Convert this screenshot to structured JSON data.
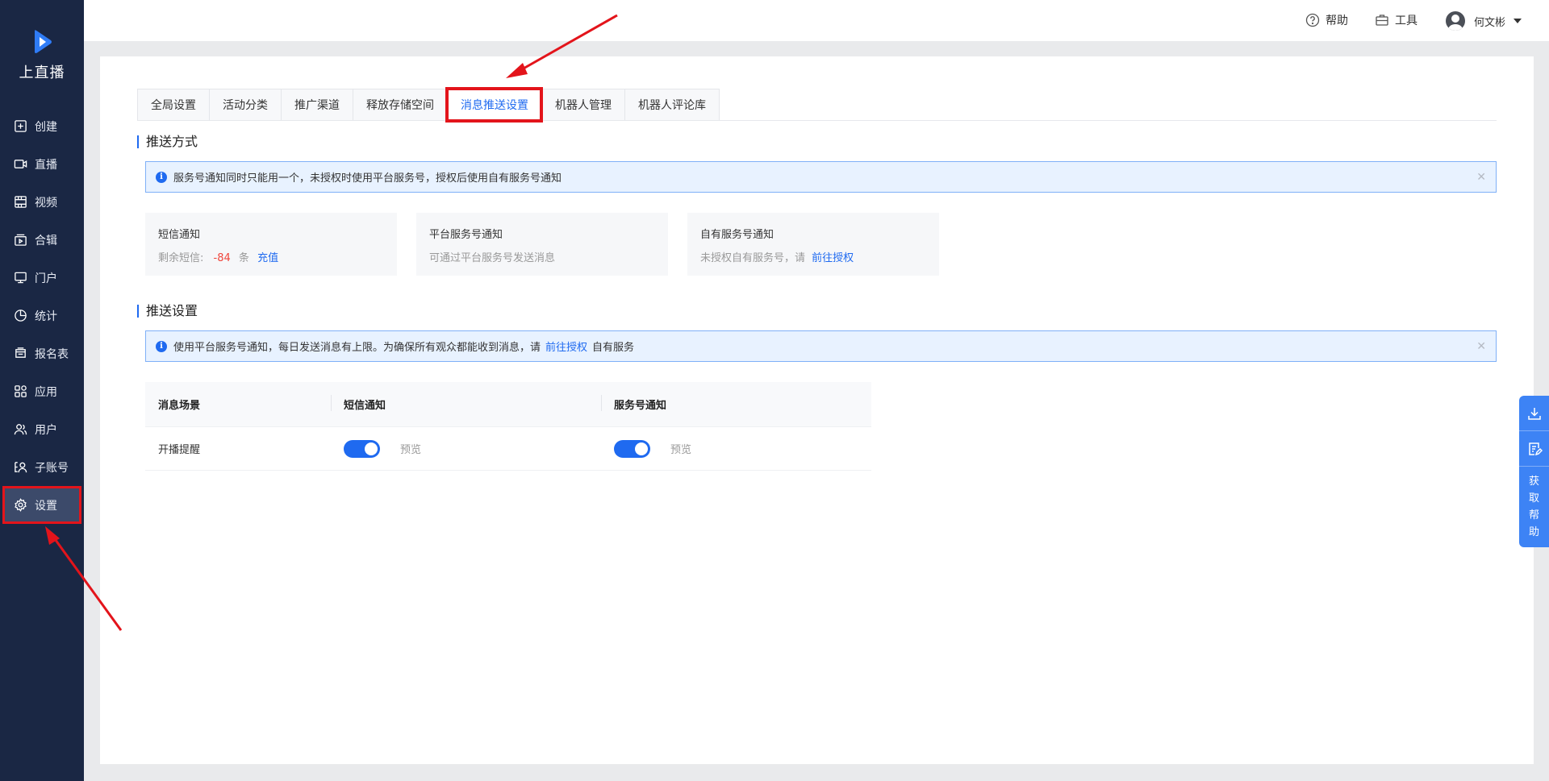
{
  "brand": {
    "name": "上直播"
  },
  "sidebar": {
    "items": [
      {
        "label": "创建",
        "icon": "plus-square-icon"
      },
      {
        "label": "直播",
        "icon": "video-camera-icon"
      },
      {
        "label": "视频",
        "icon": "film-icon"
      },
      {
        "label": "合辑",
        "icon": "collection-icon"
      },
      {
        "label": "门户",
        "icon": "monitor-icon"
      },
      {
        "label": "统计",
        "icon": "pie-chart-icon"
      },
      {
        "label": "报名表",
        "icon": "form-icon"
      },
      {
        "label": "应用",
        "icon": "apps-icon"
      },
      {
        "label": "用户",
        "icon": "users-icon"
      },
      {
        "label": "子账号",
        "icon": "sub-account-icon"
      },
      {
        "label": "设置",
        "icon": "gear-icon",
        "active": true
      }
    ]
  },
  "header": {
    "help": "帮助",
    "tools": "工具",
    "user": "何文彬"
  },
  "tabs": [
    "全局设置",
    "活动分类",
    "推广渠道",
    "释放存储空间",
    "消息推送设置",
    "机器人管理",
    "机器人评论库"
  ],
  "active_tab": "消息推送设置",
  "push_method": {
    "title": "推送方式",
    "alert": "服务号通知同时只能用一个，未授权时使用平台服务号，授权后使用自有服务号通知",
    "sms": {
      "title": "短信通知",
      "remain_prefix": "剩余短信:",
      "remain_value": "-84",
      "remain_unit": "条",
      "recharge": "充值"
    },
    "platform": {
      "title": "平台服务号通知",
      "desc": "可通过平台服务号发送消息"
    },
    "own": {
      "title": "自有服务号通知",
      "desc": "未授权自有服务号，请",
      "link": "前往授权"
    }
  },
  "push_settings": {
    "title": "推送设置",
    "alert_prefix": "使用平台服务号通知，每日发送消息有上限。为确保所有观众都能收到消息，请",
    "alert_link": "前往授权",
    "alert_suffix": "自有服务",
    "columns": [
      "消息场景",
      "短信通知",
      "服务号通知"
    ],
    "rows": [
      {
        "scene": "开播提醒",
        "sms_on": true,
        "service_on": true,
        "preview": "预览"
      }
    ]
  },
  "float_panel": {
    "help_text": "获取帮助"
  },
  "colors": {
    "sidebar": "#1a2744",
    "accent": "#1f6af0",
    "highlight": "#e3141b"
  }
}
